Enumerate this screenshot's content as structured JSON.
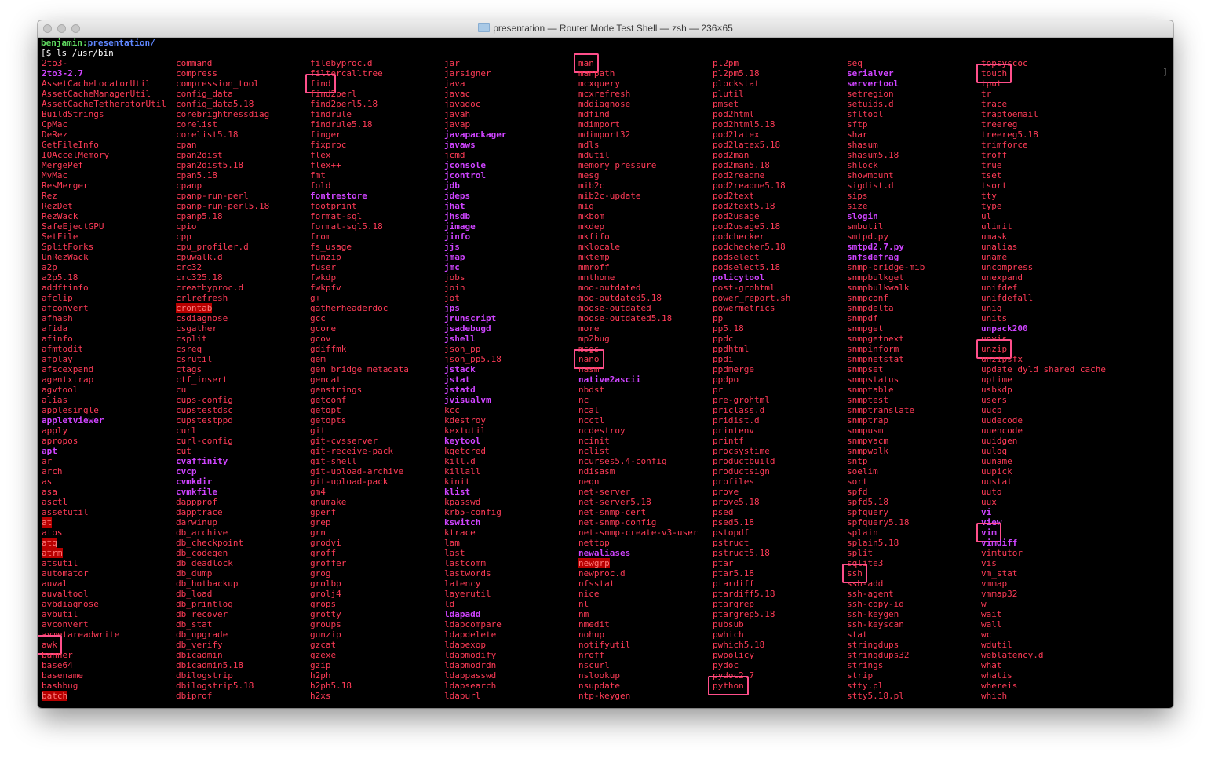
{
  "window": {
    "title": "presentation — Router Mode Test Shell — zsh — 236×65"
  },
  "prompt": {
    "user": "benjamin:",
    "path": "presentation/",
    "command": "[$ ls /usr/bin"
  },
  "columns": [
    [
      "2to3-",
      "2to3-2.7",
      "AssetCacheLocatorUtil",
      "AssetCacheManagerUtil",
      "AssetCacheTetheratorUtil",
      "BuildStrings",
      "CpMac",
      "DeRez",
      "GetFileInfo",
      "IOAccelMemory",
      "MergePef",
      "MvMac",
      "ResMerger",
      "Rez",
      "RezDet",
      "RezWack",
      "SafeEjectGPU",
      "SetFile",
      "SplitForks",
      "UnRezWack",
      "a2p",
      "a2p5.18",
      "addftinfo",
      "afclip",
      "afconvert",
      "afhash",
      "afida",
      "afinfo",
      "afmtodit",
      "afplay",
      "afscexpand",
      "agentxtrap",
      "agvtool",
      "alias",
      "applesingle",
      "appletviewer",
      "apply",
      "apropos",
      "apt",
      "ar",
      "arch",
      "as",
      "asa",
      "asctl",
      "assetutil",
      "at",
      "atos",
      "atq",
      "atrm",
      "atsutil",
      "automator",
      "auval",
      "auvaltool",
      "avbdiagnose",
      "avbutil",
      "avconvert",
      "avmetareadwrite",
      "awk",
      "banner",
      "base64",
      "basename",
      "bashbug",
      "batch"
    ],
    [
      "command",
      "compress",
      "compression_tool",
      "config_data",
      "config_data5.18",
      "corebrightnessdiag",
      "corelist",
      "corelist5.18",
      "cpan",
      "cpan2dist",
      "cpan2dist5.18",
      "cpan5.18",
      "cpanp",
      "cpanp-run-perl",
      "cpanp-run-perl5.18",
      "cpanp5.18",
      "cpio",
      "cpp",
      "cpu_profiler.d",
      "cpuwalk.d",
      "crc32",
      "crc325.18",
      "creatbyproc.d",
      "crlrefresh",
      "crontab",
      "csdiagnose",
      "csgather",
      "csplit",
      "csreq",
      "csrutil",
      "ctags",
      "ctf_insert",
      "cu",
      "cups-config",
      "cupstestdsc",
      "cupstestppd",
      "curl",
      "curl-config",
      "cut",
      "cvaffinity",
      "cvcp",
      "cvmkdir",
      "cvmkfile",
      "dappprof",
      "dapptrace",
      "darwinup",
      "db_archive",
      "db_checkpoint",
      "db_codegen",
      "db_deadlock",
      "db_dump",
      "db_hotbackup",
      "db_load",
      "db_printlog",
      "db_recover",
      "db_stat",
      "db_upgrade",
      "db_verify",
      "dbicadmin",
      "dbicadmin5.18",
      "dbilogstrip",
      "dbilogstrip5.18",
      "dbiprof"
    ],
    [
      "filebyproc.d",
      "filtercalltree",
      "find",
      "find2perl",
      "find2perl5.18",
      "findrule",
      "findrule5.18",
      "finger",
      "fixproc",
      "flex",
      "flex++",
      "fmt",
      "fold",
      "fontrestore",
      "footprint",
      "format-sql",
      "format-sql5.18",
      "from",
      "fs_usage",
      "funzip",
      "fuser",
      "fwkdp",
      "fwkpfv",
      "g++",
      "gatherheaderdoc",
      "gcc",
      "gcore",
      "gcov",
      "gdiffmk",
      "gem",
      "gen_bridge_metadata",
      "gencat",
      "genstrings",
      "getconf",
      "getopt",
      "getopts",
      "git",
      "git-cvsserver",
      "git-receive-pack",
      "git-shell",
      "git-upload-archive",
      "git-upload-pack",
      "gm4",
      "gnumake",
      "gperf",
      "grep",
      "grn",
      "grodvi",
      "groff",
      "groffer",
      "grog",
      "grolbp",
      "grolj4",
      "grops",
      "grotty",
      "groups",
      "gunzip",
      "gzcat",
      "gzexe",
      "gzip",
      "h2ph",
      "h2ph5.18",
      "h2xs"
    ],
    [
      "jar",
      "jarsigner",
      "java",
      "javac",
      "javadoc",
      "javah",
      "javap",
      "javapackager",
      "javaws",
      "jcmd",
      "jconsole",
      "jcontrol",
      "jdb",
      "jdeps",
      "jhat",
      "jhsdb",
      "jimage",
      "jinfo",
      "jjs",
      "jmap",
      "jmc",
      "jobs",
      "join",
      "jot",
      "jps",
      "jrunscript",
      "jsadebugd",
      "jshell",
      "json_pp",
      "json_pp5.18",
      "jstack",
      "jstat",
      "jstatd",
      "jvisualvm",
      "kcc",
      "kdestroy",
      "kextutil",
      "keytool",
      "kgetcred",
      "kill.d",
      "killall",
      "kinit",
      "klist",
      "kpasswd",
      "krb5-config",
      "kswitch",
      "ktrace",
      "lam",
      "last",
      "lastcomm",
      "lastwords",
      "latency",
      "layerutil",
      "ld",
      "ldapadd",
      "ldapcompare",
      "ldapdelete",
      "ldapexop",
      "ldapmodify",
      "ldapmodrdn",
      "ldappasswd",
      "ldapsearch",
      "ldapurl"
    ],
    [
      "man",
      "manpath",
      "mcxquery",
      "mcxrefresh",
      "mddiagnose",
      "mdfind",
      "mdimport",
      "mdimport32",
      "mdls",
      "mdutil",
      "memory_pressure",
      "mesg",
      "mib2c",
      "mib2c-update",
      "mig",
      "mkbom",
      "mkdep",
      "mkfifo",
      "mklocale",
      "mktemp",
      "mmroff",
      "mnthome",
      "moo-outdated",
      "moo-outdated5.18",
      "moose-outdated",
      "moose-outdated5.18",
      "more",
      "mp2bug",
      "msgs",
      "nano",
      "nasm",
      "native2ascii",
      "nbdst",
      "nc",
      "ncal",
      "ncctl",
      "ncdestroy",
      "ncinit",
      "nclist",
      "ncurses5.4-config",
      "ndisasm",
      "neqn",
      "net-server",
      "net-server5.18",
      "net-snmp-cert",
      "net-snmp-config",
      "net-snmp-create-v3-user",
      "nettop",
      "newaliases",
      "newgrp",
      "newproc.d",
      "nfsstat",
      "nice",
      "nl",
      "nm",
      "nmedit",
      "nohup",
      "notifyutil",
      "nroff",
      "nscurl",
      "nslookup",
      "nsupdate",
      "ntp-keygen"
    ],
    [
      "pl2pm",
      "pl2pm5.18",
      "plockstat",
      "plutil",
      "pmset",
      "pod2html",
      "pod2html5.18",
      "pod2latex",
      "pod2latex5.18",
      "pod2man",
      "pod2man5.18",
      "pod2readme",
      "pod2readme5.18",
      "pod2text",
      "pod2text5.18",
      "pod2usage",
      "pod2usage5.18",
      "podchecker",
      "podchecker5.18",
      "podselect",
      "podselect5.18",
      "policytool",
      "post-grohtml",
      "power_report.sh",
      "powermetrics",
      "pp",
      "pp5.18",
      "ppdc",
      "ppdhtml",
      "ppdi",
      "ppdmerge",
      "ppdpo",
      "pr",
      "pre-grohtml",
      "priclass.d",
      "pridist.d",
      "printenv",
      "printf",
      "procsystime",
      "productbuild",
      "productsign",
      "profiles",
      "prove",
      "prove5.18",
      "psed",
      "psed5.18",
      "pstopdf",
      "pstruct",
      "pstruct5.18",
      "ptar",
      "ptar5.18",
      "ptardiff",
      "ptardiff5.18",
      "ptargrep",
      "ptargrep5.18",
      "pubsub",
      "pwhich",
      "pwhich5.18",
      "pwpolicy",
      "pydoc",
      "pydoc2.7",
      "python"
    ],
    [
      "seq",
      "serialver",
      "servertool",
      "setregion",
      "setuids.d",
      "sfltool",
      "sftp",
      "shar",
      "shasum",
      "shasum5.18",
      "shlock",
      "showmount",
      "sigdist.d",
      "sips",
      "size",
      "slogin",
      "smbutil",
      "smtpd.py",
      "smtpd2.7.py",
      "snfsdefrag",
      "snmp-bridge-mib",
      "snmpbulkget",
      "snmpbulkwalk",
      "snmpconf",
      "snmpdelta",
      "snmpdf",
      "snmpget",
      "snmpgetnext",
      "snmpinform",
      "snmpnetstat",
      "snmpset",
      "snmpstatus",
      "snmptable",
      "snmptest",
      "snmptranslate",
      "snmptrap",
      "snmpusm",
      "snmpvacm",
      "snmpwalk",
      "sntp",
      "soelim",
      "sort",
      "spfd",
      "spfd5.18",
      "spfquery",
      "spfquery5.18",
      "splain",
      "splain5.18",
      "split",
      "sqlite3",
      "ssh",
      "ssh-add",
      "ssh-agent",
      "ssh-copy-id",
      "ssh-keygen",
      "ssh-keyscan",
      "stat",
      "stringdups",
      "stringdups32",
      "strings",
      "strip",
      "stty.pl",
      "stty5.18.pl"
    ],
    [
      "topsyscoc",
      "touch",
      "tput",
      "tr",
      "trace",
      "traptoemail",
      "treereg",
      "treereg5.18",
      "trimforce",
      "troff",
      "true",
      "tset",
      "tsort",
      "tty",
      "type",
      "ul",
      "ulimit",
      "umask",
      "unalias",
      "uname",
      "uncompress",
      "unexpand",
      "unifdef",
      "unifdefall",
      "uniq",
      "units",
      "unpack200",
      "unvis",
      "unzip",
      "unzipsfx",
      "update_dyld_shared_cache",
      "uptime",
      "usbkdp",
      "users",
      "uucp",
      "uudecode",
      "uuencode",
      "uuidgen",
      "uulog",
      "uuname",
      "uupick",
      "uustat",
      "uuto",
      "uux",
      "vi",
      "view",
      "vim",
      "vimdiff",
      "vimtutor",
      "vis",
      "vm_stat",
      "vmmap",
      "vmmap32",
      "w",
      "wait",
      "wall",
      "wc",
      "wdutil",
      "weblatency.d",
      "what",
      "whatis",
      "whereis",
      "which"
    ]
  ],
  "styled_entries": {
    "dir": [
      "2to3-2.7",
      "appletviewer",
      "apt",
      "cvaffinity",
      "cvcp",
      "cvmkdir",
      "cvmkfile",
      "fontrestore",
      "javapackager",
      "javaws",
      "jconsole",
      "jcontrol",
      "jdb",
      "jdeps",
      "jhat",
      "jhsdb",
      "jimage",
      "jinfo",
      "jjs",
      "jmap",
      "jmc",
      "jps",
      "jrunscript",
      "jsadebugd",
      "jshell",
      "jstack",
      "jstat",
      "jstatd",
      "jvisualvm",
      "keytool",
      "klist",
      "kswitch",
      "ldapadd",
      "native2ascii",
      "newaliases",
      "policytool",
      "serialver",
      "servertool",
      "slogin",
      "smtpd2.7.py",
      "snfsdefrag",
      "unpack200",
      "vi",
      "view",
      "vim",
      "vimdiff"
    ],
    "setuid": [
      "crontab",
      "at",
      "atq",
      "atrm",
      "batch",
      "newgrp"
    ],
    "highlighted": [
      "find",
      "man",
      "nano",
      "awk",
      "python",
      "ssh",
      "touch",
      "unzip",
      "vim"
    ]
  },
  "colors": {
    "exec": "#ff3b57",
    "dir": "#cf44ff",
    "highlight_box": "#ff4f8b",
    "setuid_bg": "#b80000"
  }
}
